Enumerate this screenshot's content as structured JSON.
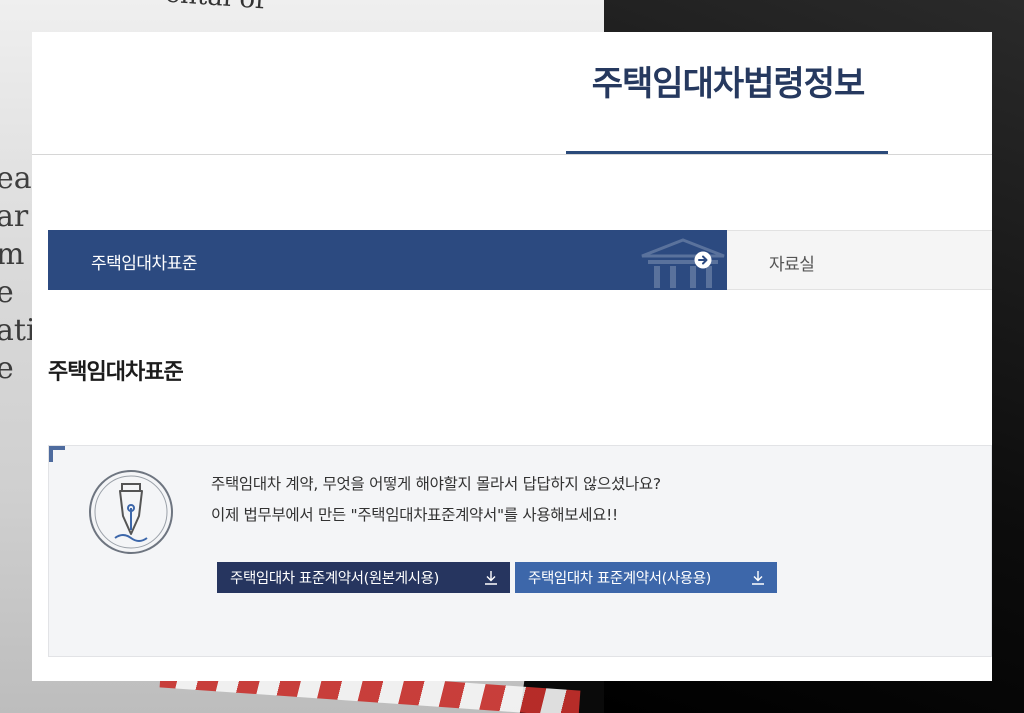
{
  "header": {
    "site_title": "주택임대차법령정보"
  },
  "tabs": [
    {
      "label": "주택임대차표준",
      "active": true
    },
    {
      "label": "자료실",
      "active": false
    }
  ],
  "section": {
    "title": "주택임대차표준"
  },
  "info": {
    "line1": "주택임대차 계약, 무엇을 어떻게 해야할지 몰라서 답답하지 않으셨나요?",
    "line2": "이제 법무부에서 만든 \"주택임대차표준계약서\"를 사용해보세요!!",
    "buttons": [
      {
        "label": "주택임대차 표준계약서(원본게시용)",
        "icon": "download-icon"
      },
      {
        "label": "주택임대차 표준계약서(사용용)",
        "icon": "download-icon"
      }
    ]
  },
  "colors": {
    "primary_navy": "#2c4a80",
    "title_navy": "#26395f",
    "button_dark": "#26355f",
    "button_light": "#3d67aa"
  },
  "background": {
    "top_text": "ental of",
    "side_letters": [
      "ea",
      "ar",
      "m",
      "e",
      "ati",
      "e"
    ]
  }
}
